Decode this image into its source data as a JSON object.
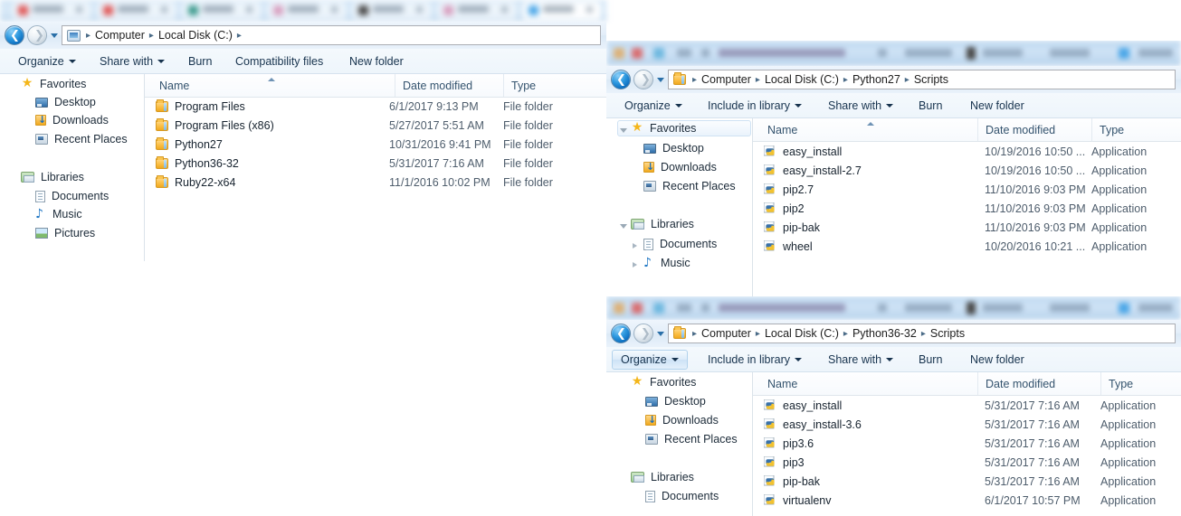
{
  "browser_tabstrip": {
    "note": "blurred browser tab strip",
    "tabs": [
      {
        "favicon_color": "#e05a5a"
      },
      {
        "favicon_color": "#e05a5a"
      },
      {
        "favicon_color": "#3f9c8f"
      },
      {
        "favicon_color": "#d8a0c0"
      },
      {
        "favicon_color": "#4a4a4a"
      },
      {
        "favicon_color": "#d8a0c0"
      },
      {
        "favicon_color": "#4ea8e8"
      }
    ]
  },
  "windows": [
    {
      "id": "local-disk-c",
      "nav": {
        "back_label": "Back",
        "forward_label": "Forward",
        "history_label": "Recent pages"
      },
      "address": {
        "icon": "computer-icon",
        "crumbs": [
          "Computer",
          "Local Disk (C:)"
        ],
        "separator": "▸"
      },
      "toolbar": [
        {
          "label": "Organize",
          "dropdown": true,
          "hover": false
        },
        {
          "label": "Share with",
          "dropdown": true,
          "hover": false
        },
        {
          "label": "Burn",
          "dropdown": false,
          "hover": false
        },
        {
          "label": "Compatibility files",
          "dropdown": false,
          "hover": false
        },
        {
          "label": "New folder",
          "dropdown": false,
          "hover": false
        }
      ],
      "navpane": [
        {
          "label": "Favorites",
          "icon": "star-icon",
          "level": 0,
          "selected": false,
          "twisty": "none"
        },
        {
          "label": "Desktop",
          "icon": "desktop-icon",
          "level": 1,
          "selected": false,
          "twisty": "none"
        },
        {
          "label": "Downloads",
          "icon": "downloads-icon",
          "level": 1,
          "selected": false,
          "twisty": "none"
        },
        {
          "label": "Recent Places",
          "icon": "recent-places-icon",
          "level": 1,
          "selected": false,
          "twisty": "none"
        },
        {
          "label": "Libraries",
          "icon": "libraries-icon",
          "level": 0,
          "selected": false,
          "twisty": "none"
        },
        {
          "label": "Documents",
          "icon": "documents-icon",
          "level": 1,
          "selected": false,
          "twisty": "none"
        },
        {
          "label": "Music",
          "icon": "music-icon",
          "level": 1,
          "selected": false,
          "twisty": "none"
        },
        {
          "label": "Pictures",
          "icon": "pictures-icon",
          "level": 1,
          "selected": false,
          "twisty": "none"
        }
      ],
      "columns": [
        {
          "label": "Name",
          "sorted": true
        },
        {
          "label": "Date modified",
          "sorted": false
        },
        {
          "label": "Type",
          "sorted": false
        }
      ],
      "rows": [
        {
          "icon": "folder-icon",
          "name": "Program Files",
          "date": "6/1/2017 9:13 PM",
          "type": "File folder"
        },
        {
          "icon": "folder-icon",
          "name": "Program Files (x86)",
          "date": "5/27/2017 5:51 AM",
          "type": "File folder"
        },
        {
          "icon": "folder-icon",
          "name": "Python27",
          "date": "10/31/2016 9:41 PM",
          "type": "File folder"
        },
        {
          "icon": "folder-icon",
          "name": "Python36-32",
          "date": "5/31/2017 7:16 AM",
          "type": "File folder"
        },
        {
          "icon": "folder-icon",
          "name": "Ruby22-x64",
          "date": "11/1/2016 10:02 PM",
          "type": "File folder"
        }
      ]
    },
    {
      "id": "python27-scripts",
      "nav": {
        "back_label": "Back",
        "forward_label": "Forward",
        "history_label": "Recent pages"
      },
      "address": {
        "icon": "folder-icon",
        "crumbs": [
          "Computer",
          "Local Disk (C:)",
          "Python27",
          "Scripts"
        ],
        "separator": "▸"
      },
      "toolbar": [
        {
          "label": "Organize",
          "dropdown": true,
          "hover": false
        },
        {
          "label": "Include in library",
          "dropdown": true,
          "hover": false
        },
        {
          "label": "Share with",
          "dropdown": true,
          "hover": false
        },
        {
          "label": "Burn",
          "dropdown": false,
          "hover": false
        },
        {
          "label": "New folder",
          "dropdown": false,
          "hover": false
        }
      ],
      "navpane": [
        {
          "label": "Favorites",
          "icon": "star-icon",
          "level": 0,
          "selected": true,
          "twisty": "open"
        },
        {
          "label": "Desktop",
          "icon": "desktop-icon",
          "level": 1,
          "selected": false,
          "twisty": "none"
        },
        {
          "label": "Downloads",
          "icon": "downloads-icon",
          "level": 1,
          "selected": false,
          "twisty": "none"
        },
        {
          "label": "Recent Places",
          "icon": "recent-places-icon",
          "level": 1,
          "selected": false,
          "twisty": "none"
        },
        {
          "label": "Libraries",
          "icon": "libraries-icon",
          "level": 0,
          "selected": false,
          "twisty": "open"
        },
        {
          "label": "Documents",
          "icon": "documents-icon",
          "level": 1,
          "selected": false,
          "twisty": "closed"
        },
        {
          "label": "Music",
          "icon": "music-icon",
          "level": 1,
          "selected": false,
          "twisty": "closed"
        }
      ],
      "columns": [
        {
          "label": "Name",
          "sorted": true
        },
        {
          "label": "Date modified",
          "sorted": false
        },
        {
          "label": "Type",
          "sorted": false
        }
      ],
      "rows": [
        {
          "icon": "python-app-icon",
          "name": "easy_install",
          "date": "10/19/2016 10:50 ...",
          "type": "Application"
        },
        {
          "icon": "python-app-icon",
          "name": "easy_install-2.7",
          "date": "10/19/2016 10:50 ...",
          "type": "Application"
        },
        {
          "icon": "python-app-icon",
          "name": "pip2.7",
          "date": "11/10/2016 9:03 PM",
          "type": "Application"
        },
        {
          "icon": "python-app-icon",
          "name": "pip2",
          "date": "11/10/2016 9:03 PM",
          "type": "Application"
        },
        {
          "icon": "python-app-icon",
          "name": "pip-bak",
          "date": "11/10/2016 9:03 PM",
          "type": "Application"
        },
        {
          "icon": "python-app-icon",
          "name": "wheel",
          "date": "10/20/2016 10:21 ...",
          "type": "Application"
        }
      ]
    },
    {
      "id": "python36-32-scripts",
      "nav": {
        "back_label": "Back",
        "forward_label": "Forward",
        "history_label": "Recent pages"
      },
      "address": {
        "icon": "folder-icon",
        "crumbs": [
          "Computer",
          "Local Disk (C:)",
          "Python36-32",
          "Scripts"
        ],
        "separator": "▸"
      },
      "toolbar": [
        {
          "label": "Organize",
          "dropdown": true,
          "hover": true
        },
        {
          "label": "Include in library",
          "dropdown": true,
          "hover": false
        },
        {
          "label": "Share with",
          "dropdown": true,
          "hover": false
        },
        {
          "label": "Burn",
          "dropdown": false,
          "hover": false
        },
        {
          "label": "New folder",
          "dropdown": false,
          "hover": false
        }
      ],
      "navpane": [
        {
          "label": "Favorites",
          "icon": "star-icon",
          "level": 0,
          "selected": false,
          "twisty": "none"
        },
        {
          "label": "Desktop",
          "icon": "desktop-icon",
          "level": 1,
          "selected": false,
          "twisty": "none"
        },
        {
          "label": "Downloads",
          "icon": "downloads-icon",
          "level": 1,
          "selected": false,
          "twisty": "none"
        },
        {
          "label": "Recent Places",
          "icon": "recent-places-icon",
          "level": 1,
          "selected": false,
          "twisty": "none"
        },
        {
          "label": "Libraries",
          "icon": "libraries-icon",
          "level": 0,
          "selected": false,
          "twisty": "none"
        },
        {
          "label": "Documents",
          "icon": "documents-icon",
          "level": 1,
          "selected": false,
          "twisty": "none"
        }
      ],
      "columns": [
        {
          "label": "Name",
          "sorted": false
        },
        {
          "label": "Date modified",
          "sorted": false
        },
        {
          "label": "Type",
          "sorted": false
        }
      ],
      "rows": [
        {
          "icon": "python-app-icon",
          "name": "easy_install",
          "date": "5/31/2017 7:16 AM",
          "type": "Application"
        },
        {
          "icon": "python-app-icon",
          "name": "easy_install-3.6",
          "date": "5/31/2017 7:16 AM",
          "type": "Application"
        },
        {
          "icon": "python-app-icon",
          "name": "pip3.6",
          "date": "5/31/2017 7:16 AM",
          "type": "Application"
        },
        {
          "icon": "python-app-icon",
          "name": "pip3",
          "date": "5/31/2017 7:16 AM",
          "type": "Application"
        },
        {
          "icon": "python-app-icon",
          "name": "pip-bak",
          "date": "5/31/2017 7:16 AM",
          "type": "Application"
        },
        {
          "icon": "python-app-icon",
          "name": "virtualenv",
          "date": "6/1/2017 10:57 PM",
          "type": "Application"
        }
      ]
    }
  ],
  "colors": {
    "accent_blue": "#2f9ae0",
    "folder_yellow": "#f0a91f",
    "toolbar_bg": "#eef5fb",
    "header_text": "#34536e"
  }
}
